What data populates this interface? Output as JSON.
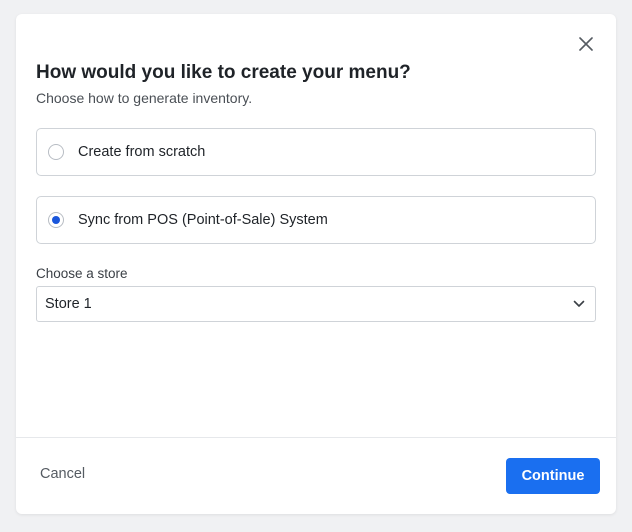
{
  "modal": {
    "title": "How would you like to create your menu?",
    "subtitle": "Choose how to generate inventory.",
    "close_icon": "close-icon"
  },
  "options": [
    {
      "label": "Create from scratch",
      "selected": false
    },
    {
      "label": "Sync from POS (Point-of-Sale) System",
      "selected": true
    }
  ],
  "store_select": {
    "label": "Choose a store",
    "value": "Store 1",
    "icon": "chevron-down-icon"
  },
  "footer": {
    "cancel_label": "Cancel",
    "continue_label": "Continue"
  },
  "colors": {
    "accent": "#1a6ff0",
    "radio_selected": "#1a56db"
  }
}
